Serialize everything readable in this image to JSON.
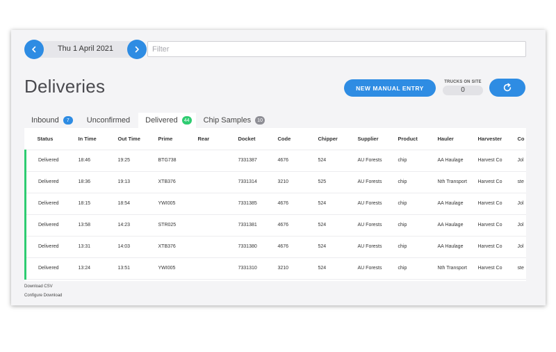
{
  "nav": {
    "date": "Thu 1 April 2021",
    "filter_placeholder": "Filter"
  },
  "page": {
    "title": "Deliveries"
  },
  "actions": {
    "manual_entry": "NEW MANUAL ENTRY",
    "trucks_label": "TRUCKS ON SITE",
    "trucks_value": "0",
    "refresh_icon": "refresh-icon"
  },
  "tabs": [
    {
      "label": "Inbound",
      "count": "7",
      "badge_color": "#2e8ce3"
    },
    {
      "label": "Unconfirmed",
      "count": "",
      "badge_color": ""
    },
    {
      "label": "Delivered",
      "count": "44",
      "badge_color": "#2ecc71"
    },
    {
      "label": "Chip Samples",
      "count": "10",
      "badge_color": "#8e8e95"
    }
  ],
  "table": {
    "headers": [
      "Status",
      "In Time",
      "Out Time",
      "Prime",
      "Rear",
      "Docket",
      "Code",
      "Chipper",
      "Supplier",
      "Product",
      "Hauler",
      "Harvester",
      "Co"
    ],
    "rows": [
      [
        "Delivered",
        "18:46",
        "19:25",
        "BTG738",
        "",
        "7331387",
        "4676",
        "524",
        "AU Forests",
        "chip",
        "AA Haulage",
        "Harvest Co",
        "Jol"
      ],
      [
        "Delivered",
        "18:36",
        "19:13",
        "XTB376",
        "",
        "7331314",
        "3210",
        "525",
        "AU Forests",
        "chip",
        "Nth Transport",
        "Harvest Co",
        "ste"
      ],
      [
        "Delivered",
        "18:15",
        "18:54",
        "YWI005",
        "",
        "7331385",
        "4676",
        "524",
        "AU Forests",
        "chip",
        "AA Haulage",
        "Harvest Co",
        "Jol"
      ],
      [
        "Delivered",
        "13:58",
        "14:23",
        "STR025",
        "",
        "7331381",
        "4676",
        "524",
        "AU Forests",
        "chip",
        "AA Haulage",
        "Harvest Co",
        "Jol"
      ],
      [
        "Delivered",
        "13:31",
        "14:03",
        "XTB376",
        "",
        "7331380",
        "4676",
        "524",
        "AU Forests",
        "chip",
        "AA Haulage",
        "Harvest Co",
        "Jol"
      ],
      [
        "Delivered",
        "13:24",
        "13:51",
        "YWI005",
        "",
        "7331310",
        "3210",
        "524",
        "AU Forests",
        "chip",
        "Nth Transport",
        "Harvest Co",
        "ste"
      ]
    ]
  },
  "footer": {
    "download_csv": "Download CSV",
    "configure_download": "Configure Download"
  },
  "colors": {
    "accent": "#2e8ce3",
    "status_delivered": "#2ecc71"
  }
}
